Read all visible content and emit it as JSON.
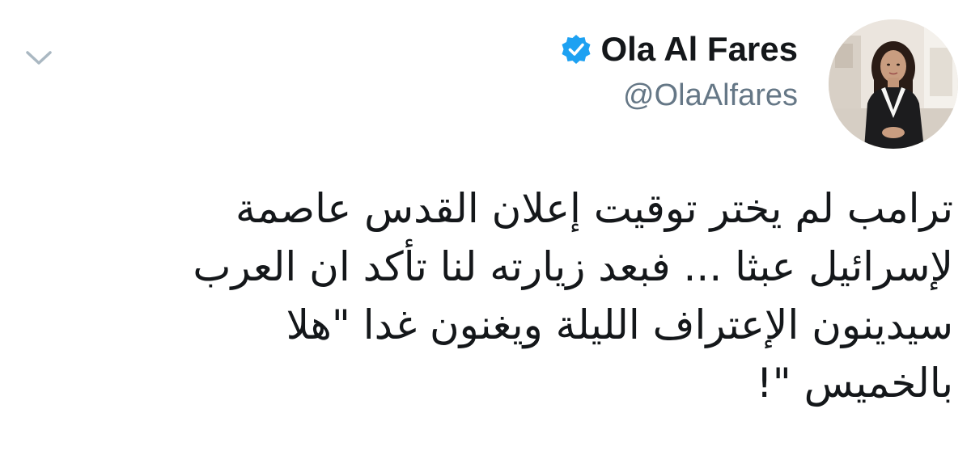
{
  "tweet": {
    "author": {
      "display_name": "Ola Al Fares",
      "handle": "@OlaAlfares",
      "verified": true
    },
    "body_lines": [
      "ترامب لم يختر توقيت إعلان القدس عاصمة",
      "لإسرائيل عبثا ... فبعد زيارته لنا تأكد ان العرب",
      "سيدينون الإعتراف الليلة  ويغنون غدا \"هلا",
      "بالخميس \"!"
    ]
  },
  "icons": {
    "menu": "chevron-down-icon",
    "verified": "verified-badge-icon",
    "avatar": "profile-photo"
  },
  "colors": {
    "verified_blue": "#1da1f2",
    "text": "#14171a",
    "handle_gray": "#657786",
    "chevron_gray": "#aab8c2"
  }
}
